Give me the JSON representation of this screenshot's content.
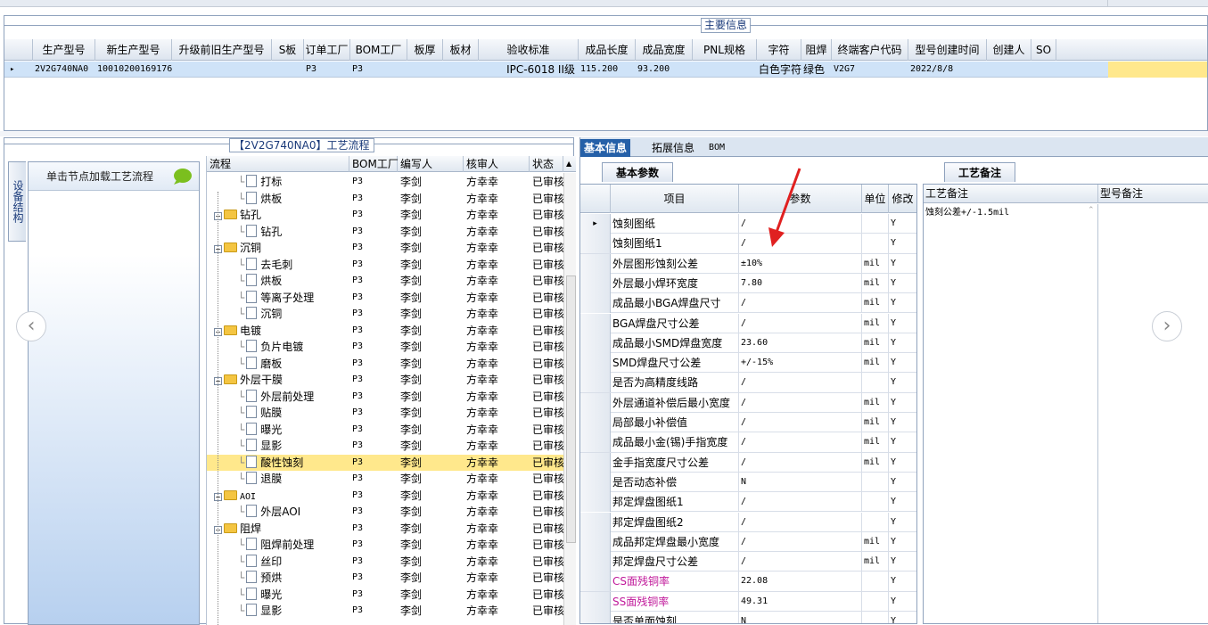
{
  "main_info": {
    "title": "主要信息",
    "columns": [
      "生产型号",
      "新生产型号",
      "升级前旧生产型号",
      "S板",
      "订单工厂",
      "BOM工厂",
      "板厚",
      "板材",
      "验收标准",
      "成品长度",
      "成品宽度",
      "PNL规格",
      "字符",
      "阻焊",
      "终端客户代码",
      "型号创建时间",
      "创建人",
      "SO"
    ],
    "row": {
      "生产型号": "2V2G740NA0",
      "新生产型号": "10010200169176",
      "订单工厂": "P3",
      "BOM工厂": "P3",
      "验收标准": "IPC-6018 II级",
      "成品长度": "115.200",
      "成品宽度": "93.200",
      "字符": "白色字符",
      "阻焊": "绿色",
      "终端客户代码": "V2G7",
      "型号创建时间": "2022/8/8"
    }
  },
  "process_panel": {
    "title": "【2V2G740NA0】工艺流程",
    "side_tab": "设备结构",
    "nav_item": "单击节点加载工艺流程",
    "columns": [
      "流程",
      "BOM工厂",
      "编写人",
      "核审人",
      "状态"
    ],
    "rows": [
      {
        "level": 1,
        "name": "打标",
        "bom": "P3",
        "writer": "李剑",
        "reviewer": "方幸幸",
        "status": "已审核"
      },
      {
        "level": 1,
        "name": "烘板",
        "bom": "P3",
        "writer": "李剑",
        "reviewer": "方幸幸",
        "status": "已审核"
      },
      {
        "level": 0,
        "name": "钻孔",
        "bom": "P3",
        "writer": "李剑",
        "reviewer": "方幸幸",
        "status": "已审核"
      },
      {
        "level": 1,
        "name": "钻孔",
        "bom": "P3",
        "writer": "李剑",
        "reviewer": "方幸幸",
        "status": "已审核"
      },
      {
        "level": 0,
        "name": "沉铜",
        "bom": "P3",
        "writer": "李剑",
        "reviewer": "方幸幸",
        "status": "已审核"
      },
      {
        "level": 1,
        "name": "去毛刺",
        "bom": "P3",
        "writer": "李剑",
        "reviewer": "方幸幸",
        "status": "已审核"
      },
      {
        "level": 1,
        "name": "烘板",
        "bom": "P3",
        "writer": "李剑",
        "reviewer": "方幸幸",
        "status": "已审核"
      },
      {
        "level": 1,
        "name": "等离子处理",
        "bom": "P3",
        "writer": "李剑",
        "reviewer": "方幸幸",
        "status": "已审核"
      },
      {
        "level": 1,
        "name": "沉铜",
        "bom": "P3",
        "writer": "李剑",
        "reviewer": "方幸幸",
        "status": "已审核"
      },
      {
        "level": 0,
        "name": "电镀",
        "bom": "P3",
        "writer": "李剑",
        "reviewer": "方幸幸",
        "status": "已审核"
      },
      {
        "level": 1,
        "name": "负片电镀",
        "bom": "P3",
        "writer": "李剑",
        "reviewer": "方幸幸",
        "status": "已审核"
      },
      {
        "level": 1,
        "name": "磨板",
        "bom": "P3",
        "writer": "李剑",
        "reviewer": "方幸幸",
        "status": "已审核"
      },
      {
        "level": 0,
        "name": "外层干膜",
        "bom": "P3",
        "writer": "李剑",
        "reviewer": "方幸幸",
        "status": "已审核"
      },
      {
        "level": 1,
        "name": "外层前处理",
        "bom": "P3",
        "writer": "李剑",
        "reviewer": "方幸幸",
        "status": "已审核"
      },
      {
        "level": 1,
        "name": "贴膜",
        "bom": "P3",
        "writer": "李剑",
        "reviewer": "方幸幸",
        "status": "已审核"
      },
      {
        "level": 1,
        "name": "曝光",
        "bom": "P3",
        "writer": "李剑",
        "reviewer": "方幸幸",
        "status": "已审核"
      },
      {
        "level": 1,
        "name": "显影",
        "bom": "P3",
        "writer": "李剑",
        "reviewer": "方幸幸",
        "status": "已审核"
      },
      {
        "level": 1,
        "name": "酸性蚀刻",
        "bom": "P3",
        "writer": "李剑",
        "reviewer": "方幸幸",
        "status": "已审核",
        "selected": true
      },
      {
        "level": 1,
        "name": "退膜",
        "bom": "P3",
        "writer": "李剑",
        "reviewer": "方幸幸",
        "status": "已审核"
      },
      {
        "level": 0,
        "name": "AOI",
        "bom": "P3",
        "writer": "李剑",
        "reviewer": "方幸幸",
        "status": "已审核"
      },
      {
        "level": 1,
        "name": "外层AOI",
        "bom": "P3",
        "writer": "李剑",
        "reviewer": "方幸幸",
        "status": "已审核"
      },
      {
        "level": 0,
        "name": "阻焊",
        "bom": "P3",
        "writer": "李剑",
        "reviewer": "方幸幸",
        "status": "已审核"
      },
      {
        "level": 1,
        "name": "阻焊前处理",
        "bom": "P3",
        "writer": "李剑",
        "reviewer": "方幸幸",
        "status": "已审核"
      },
      {
        "level": 1,
        "name": "丝印",
        "bom": "P3",
        "writer": "李剑",
        "reviewer": "方幸幸",
        "status": "已审核"
      },
      {
        "level": 1,
        "name": "预烘",
        "bom": "P3",
        "writer": "李剑",
        "reviewer": "方幸幸",
        "status": "已审核"
      },
      {
        "level": 1,
        "name": "曝光",
        "bom": "P3",
        "writer": "李剑",
        "reviewer": "方幸幸",
        "status": "已审核"
      },
      {
        "level": 1,
        "name": "显影",
        "bom": "P3",
        "writer": "李剑",
        "reviewer": "方幸幸",
        "status": "已审核"
      }
    ]
  },
  "detail_panel": {
    "tabs": [
      "基本信息",
      "拓展信息",
      "BOM"
    ],
    "subtab": "基本参数",
    "columns": [
      "项目",
      "参数",
      "单位",
      "修改"
    ],
    "rows": [
      {
        "item": "蚀刻图纸",
        "param": "/",
        "unit": "",
        "mod": "Y"
      },
      {
        "item": "蚀刻图纸1",
        "param": "/",
        "unit": "",
        "mod": "Y"
      },
      {
        "item": "外层图形蚀刻公差",
        "param": "±10%",
        "unit": "mil",
        "mod": "Y"
      },
      {
        "item": "外层最小焊环宽度",
        "param": "7.80",
        "unit": "mil",
        "mod": "Y"
      },
      {
        "item": "成品最小BGA焊盘尺寸",
        "param": "/",
        "unit": "mil",
        "mod": "Y"
      },
      {
        "item": "BGA焊盘尺寸公差",
        "param": "/",
        "unit": "mil",
        "mod": "Y"
      },
      {
        "item": "成品最小SMD焊盘宽度",
        "param": "23.60",
        "unit": "mil",
        "mod": "Y"
      },
      {
        "item": "SMD焊盘尺寸公差",
        "param": "+/-15%",
        "unit": "mil",
        "mod": "Y"
      },
      {
        "item": "是否为高精度线路",
        "param": "/",
        "unit": "",
        "mod": "Y"
      },
      {
        "item": "外层通道补偿后最小宽度",
        "param": "/",
        "unit": "mil",
        "mod": "Y"
      },
      {
        "item": "局部最小补偿值",
        "param": "/",
        "unit": "mil",
        "mod": "Y"
      },
      {
        "item": "成品最小金(锡)手指宽度",
        "param": "/",
        "unit": "mil",
        "mod": "Y"
      },
      {
        "item": "金手指宽度尺寸公差",
        "param": "/",
        "unit": "mil",
        "mod": "Y"
      },
      {
        "item": "是否动态补偿",
        "param": "N",
        "unit": "",
        "mod": "Y"
      },
      {
        "item": "邦定焊盘图纸1",
        "param": "/",
        "unit": "",
        "mod": "Y"
      },
      {
        "item": "邦定焊盘图纸2",
        "param": "/",
        "unit": "",
        "mod": "Y"
      },
      {
        "item": "成品邦定焊盘最小宽度",
        "param": "/",
        "unit": "mil",
        "mod": "Y"
      },
      {
        "item": "邦定焊盘尺寸公差",
        "param": "/",
        "unit": "mil",
        "mod": "Y"
      },
      {
        "item": "CS面残铜率",
        "param": "22.08",
        "unit": "",
        "mod": "Y",
        "pink": true
      },
      {
        "item": "SS面残铜率",
        "param": "49.31",
        "unit": "",
        "mod": "Y",
        "pink": true
      },
      {
        "item": "是否单面蚀刻",
        "param": "N",
        "unit": "",
        "mod": "Y"
      }
    ]
  },
  "remark_panel": {
    "tab": "工艺备注",
    "columns": [
      "工艺备注",
      "型号备注"
    ],
    "process_remark": "蚀刻公差+/-1.5mil",
    "model_remark": ""
  },
  "colors": {
    "accent": "#2560a8",
    "selected_row": "#ffe88c",
    "pink_text": "#c0189a",
    "annotation_arrow": "#e02020"
  },
  "icons": [
    "chevron-left-icon",
    "chevron-right-icon",
    "speech-bubble-icon",
    "folder-icon",
    "document-icon",
    "expand-icon"
  ]
}
